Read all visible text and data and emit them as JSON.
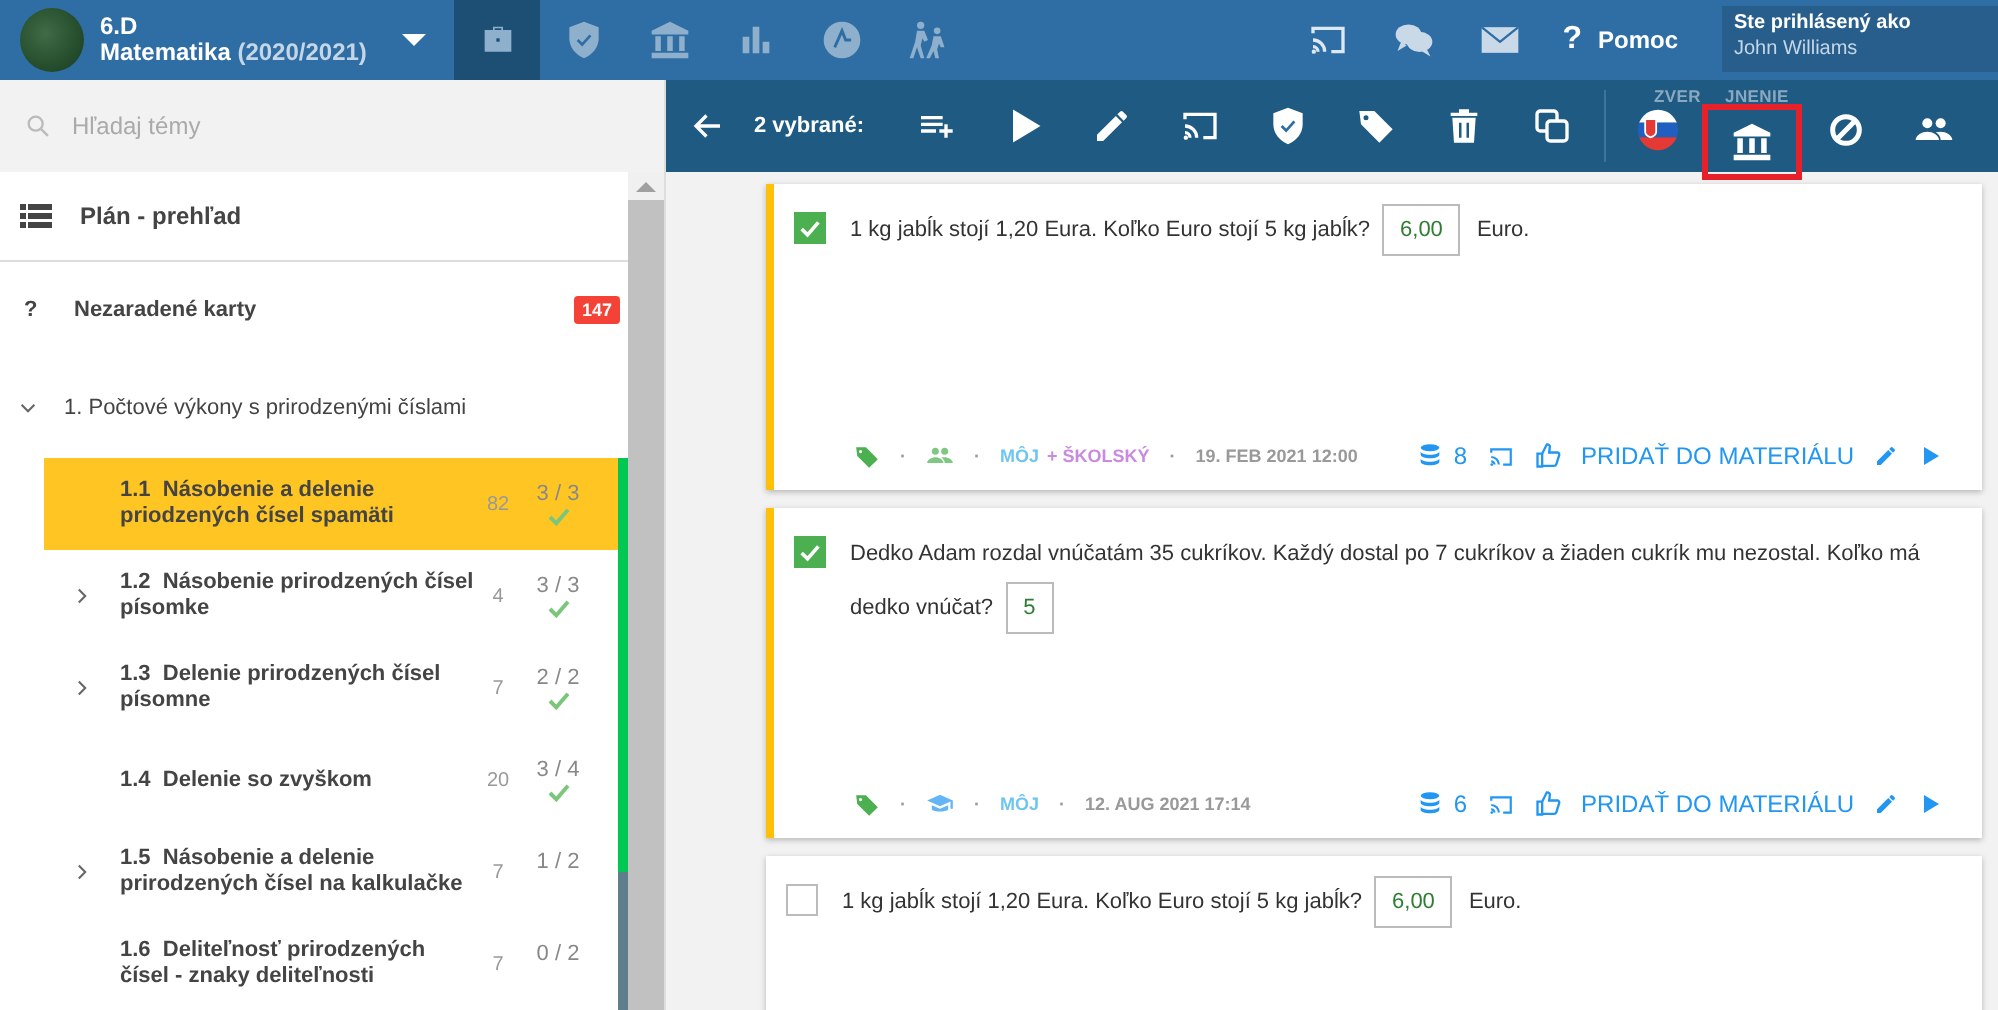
{
  "header": {
    "class_name": "6.D",
    "subject": "Matematika",
    "year": "(2020/2021)",
    "nav": [
      {
        "kind": "briefcase",
        "selected": true
      },
      {
        "kind": "shield",
        "selected": false
      },
      {
        "kind": "bank",
        "selected": false
      },
      {
        "kind": "chart",
        "selected": false
      },
      {
        "kind": "badge",
        "selected": false
      },
      {
        "kind": "walkers",
        "selected": false
      }
    ],
    "tools": [
      {
        "kind": "cast"
      },
      {
        "kind": "chat"
      },
      {
        "kind": "mail"
      }
    ],
    "help": {
      "icon": "?",
      "label": "Pomoc"
    },
    "user": {
      "caption": "Ste prihlásený ako",
      "name": "John Williams"
    }
  },
  "sidebar": {
    "search": {
      "placeholder": "Hľadaj témy"
    },
    "overview": "Plán - prehľad",
    "unassigned": {
      "icon": "?",
      "label": "Nezaradené karty",
      "badge": "147"
    },
    "groups": [
      {
        "label": "1. Počtové výkony s prirodzenými číslami",
        "expanded": true,
        "children": [
          {
            "number": "1.1",
            "title": "Násobenie a delenie priodzených čísel spamäti",
            "count": "82",
            "progress": "3 / 3",
            "done": true,
            "selected": true,
            "level": 1
          },
          {
            "number": "1.2",
            "title": "Násobenie prirodzených čísel písomke",
            "count": "4",
            "progress": "3 / 3",
            "done": true,
            "selected": false,
            "expanded": false,
            "level": 1
          },
          {
            "number": "1.3",
            "title": "Delenie prirodzených čísel písomne",
            "count": "7",
            "progress": "2 / 2",
            "done": true,
            "selected": false,
            "expanded": false,
            "level": 1
          },
          {
            "number": "1.4",
            "title": "Delenie so zvyškom",
            "count": "20",
            "progress": "3 / 4",
            "done": true,
            "selected": false,
            "level": 1
          },
          {
            "number": "1.5",
            "title": "Násobenie a delenie prirodzených čísel na kalkulačke",
            "count": "7",
            "progress": "1 / 2",
            "done": false,
            "selected": false,
            "expanded": false,
            "level": 0.5
          },
          {
            "number": "1.6",
            "title": "Deliteľnosť prirodzených čísel - znaky deliteľnosti",
            "count": "7",
            "progress": "0 / 2",
            "done": false,
            "selected": false,
            "level": 0
          }
        ]
      }
    ]
  },
  "toolbar": {
    "selection": "2 vybrané:",
    "actions": [
      {
        "kind": "add-list"
      },
      {
        "kind": "play"
      },
      {
        "kind": "pencil"
      },
      {
        "kind": "cast"
      },
      {
        "kind": "shield"
      },
      {
        "kind": "tag"
      },
      {
        "kind": "trash"
      },
      {
        "kind": "copy"
      }
    ],
    "publish": {
      "label_parts": [
        "ZVER",
        "JNENIE"
      ],
      "actions": [
        {
          "kind": "flag",
          "highlighted": false
        },
        {
          "kind": "bank",
          "highlighted": true
        },
        {
          "kind": "ban",
          "highlighted": false
        },
        {
          "kind": "people",
          "highlighted": false
        }
      ]
    }
  },
  "cards": [
    {
      "checked": true,
      "question": "1 kg jabĺk stojí 1,20 Eura. Koľko Euro stojí 5 kg jabĺk?",
      "answer": "6,00",
      "suffix": "Euro.",
      "audience": {
        "kind": "people"
      },
      "separators": [
        "·",
        "·",
        "·"
      ],
      "sources": [
        {
          "label": "MÔJ",
          "color": "#6ec6f0"
        },
        {
          "label": "+ ŠKOLSKÝ",
          "color": "#c98be0"
        }
      ],
      "date": "19. FEB 2021 12:00",
      "count": "8",
      "add_label": "PRIDAŤ DO MATERIÁLU"
    },
    {
      "checked": true,
      "question": "Dedko Adam rozdal vnúčatám 35 cukríkov. Každý dostal po 7 cukríkov a žiaden cukrík mu nezostal. Koľko má dedko vnúčat?",
      "answer": "5",
      "audience": {
        "kind": "cap"
      },
      "separators": [
        "·",
        "·",
        "·"
      ],
      "sources": [
        {
          "label": "MÔJ",
          "color": "#6ec6f0"
        }
      ],
      "date": "12. AUG 2021 17:14",
      "count": "6",
      "add_label": "PRIDAŤ DO MATERIÁLU"
    },
    {
      "checked": false,
      "question": "1 kg jabĺk stojí 1,20 Eura. Koľko Euro stojí 5 kg jabĺk?",
      "answer": "6,00",
      "suffix": "Euro."
    }
  ]
}
